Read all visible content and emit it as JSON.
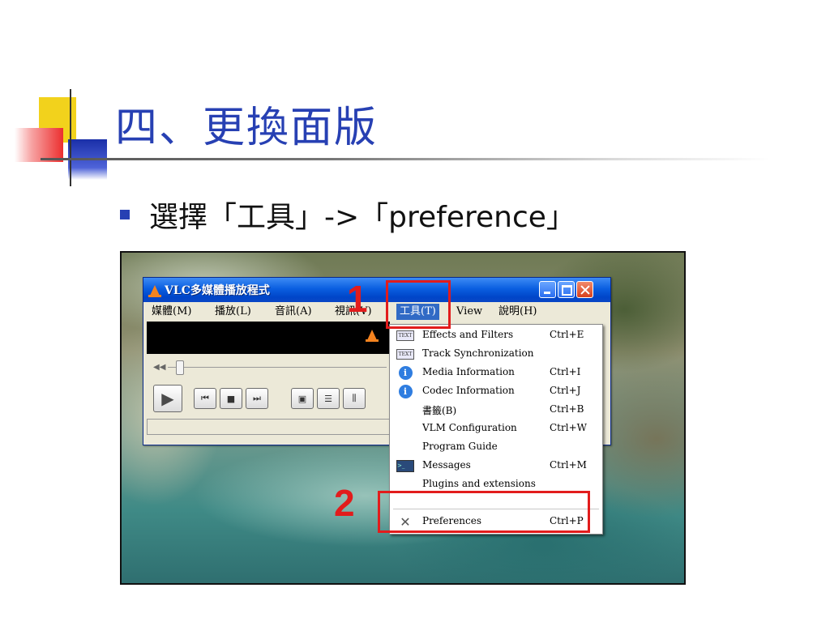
{
  "slide": {
    "title": "四、更換面版",
    "bullet": "選擇「工具」->「preference」"
  },
  "colors": {
    "title": "#2740b3",
    "highlight": "#e21c1c",
    "menu_active": "#316ac5"
  },
  "vlc": {
    "window_title": "VLC多媒體播放程式",
    "menubar": [
      {
        "label": "媒體(M)"
      },
      {
        "label": "播放(L)"
      },
      {
        "label": "音訊(A)"
      },
      {
        "label": "視訊(V)"
      },
      {
        "label": "工具(T)",
        "active": true
      },
      {
        "label": "View"
      },
      {
        "label": "說明(H)"
      }
    ],
    "controls": [
      {
        "icon": "play-icon",
        "glyph": "▶"
      },
      {
        "icon": "previous-icon",
        "glyph": "⏮"
      },
      {
        "icon": "stop-icon",
        "glyph": "■"
      },
      {
        "icon": "next-icon",
        "glyph": "⏭"
      },
      {
        "icon": "fullscreen-icon",
        "glyph": "▣"
      },
      {
        "icon": "playlist-icon",
        "glyph": "☰"
      },
      {
        "icon": "equalizer-icon",
        "glyph": "⫼"
      }
    ],
    "tools_menu": [
      {
        "icon": "text-icon",
        "label": "Effects and Filters",
        "shortcut": "Ctrl+E"
      },
      {
        "icon": "text-icon",
        "label": "Track Synchronization",
        "shortcut": ""
      },
      {
        "icon": "info-icon",
        "label": "Media Information",
        "shortcut": "Ctrl+I"
      },
      {
        "icon": "info-icon",
        "label": "Codec Information",
        "shortcut": "Ctrl+J"
      },
      {
        "icon": "",
        "label": "書籤(B)",
        "shortcut": "Ctrl+B"
      },
      {
        "icon": "",
        "label": "VLM Configuration",
        "shortcut": "Ctrl+W"
      },
      {
        "icon": "",
        "label": "Program Guide",
        "shortcut": ""
      },
      {
        "icon": "terminal-icon",
        "label": "Messages",
        "shortcut": "Ctrl+M"
      },
      {
        "icon": "",
        "label": "Plugins and extensions",
        "shortcut": ""
      },
      {
        "icon": "tools-icon",
        "label": "Preferences",
        "shortcut": "Ctrl+P"
      }
    ]
  },
  "annotations": {
    "step1": "1",
    "step2": "2"
  }
}
